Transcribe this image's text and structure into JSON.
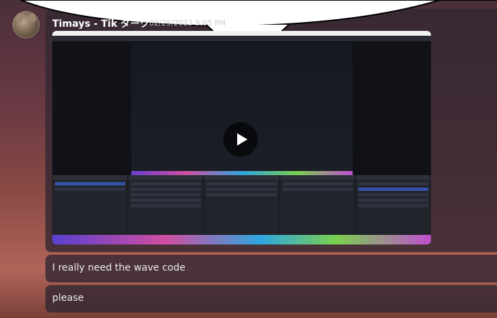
{
  "message1": {
    "username": "Timays - Tik ダーク",
    "timestamp": "02/25/2023 9:05 PM"
  },
  "video": {
    "play_icon": "play-icon"
  },
  "message2": {
    "text": "I really need the wave code"
  },
  "message3": {
    "text": "please"
  }
}
